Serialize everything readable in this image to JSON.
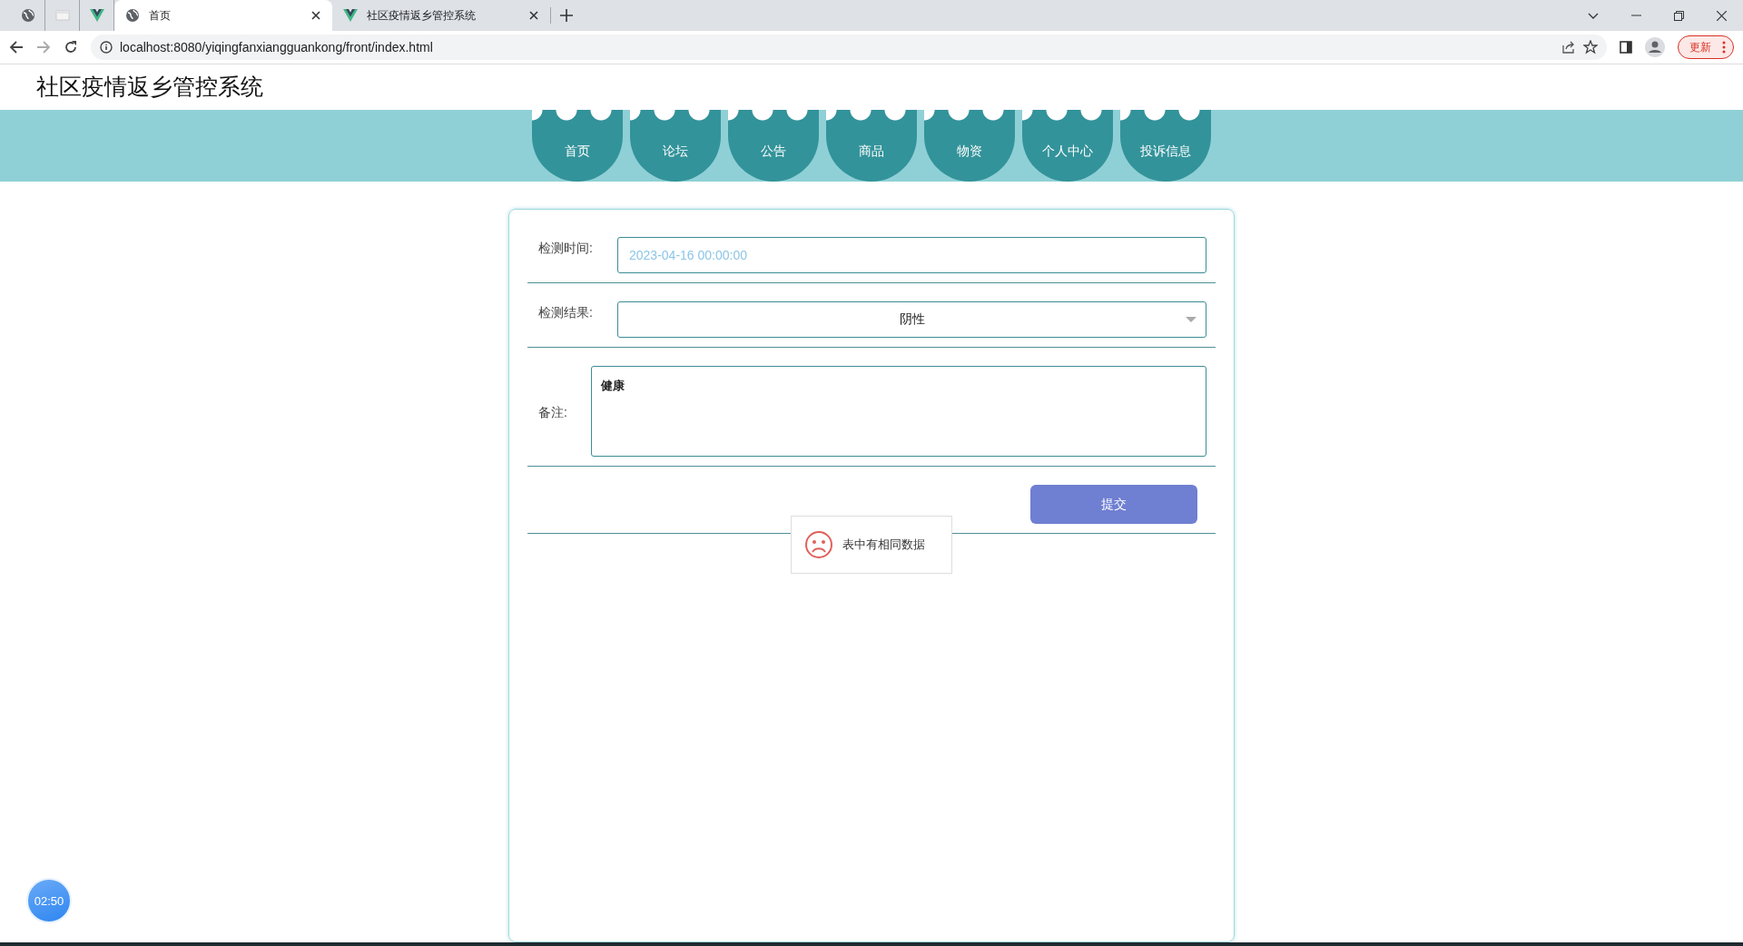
{
  "browser": {
    "tabs": [
      {
        "title": "首页",
        "kind": "site",
        "selected": true
      },
      {
        "title": "社区疫情返乡管控系统",
        "kind": "app",
        "selected": false
      }
    ],
    "url": "localhost:8080/yiqingfanxiangguankong/front/index.html",
    "update_button": "更新"
  },
  "header": {
    "title": "社区疫情返乡管控系统"
  },
  "nav": {
    "items": [
      "首页",
      "论坛",
      "公告",
      "商品",
      "物资",
      "个人中心",
      "投诉信息"
    ]
  },
  "form": {
    "fields": [
      {
        "kind": "input",
        "label": "检测时间:",
        "value": "2023-04-16 00:00:00"
      },
      {
        "kind": "select",
        "label": "检测结果:",
        "value": "阴性"
      },
      {
        "kind": "textarea",
        "label": "备注:",
        "value": "健康"
      }
    ],
    "submit": "提交"
  },
  "toast": {
    "message": "表中有相同数据"
  },
  "timer": {
    "text": "02:50"
  }
}
